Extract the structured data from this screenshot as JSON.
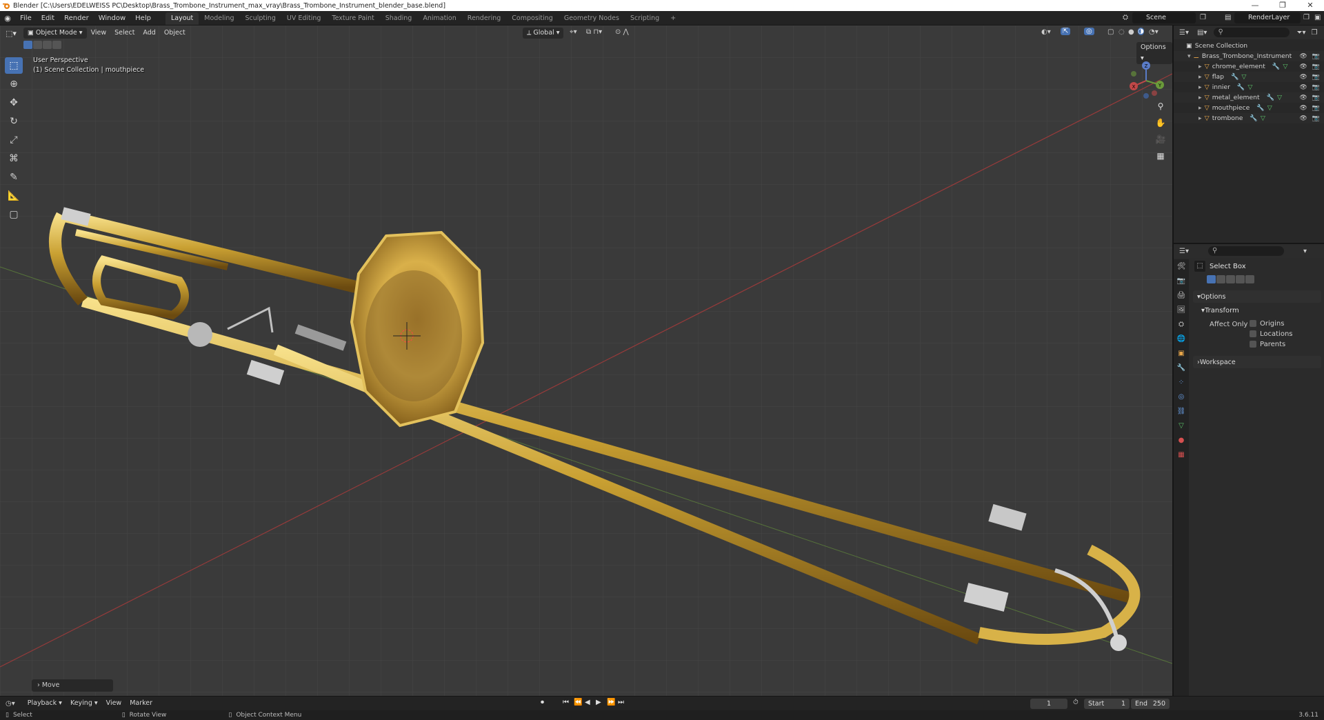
{
  "titlebar": {
    "title": "Blender [C:\\Users\\EDELWEISS PC\\Desktop\\Brass_Trombone_Instrument_max_vray\\Brass_Trombone_Instrument_blender_base.blend]",
    "minimize": "—",
    "maximize": "❐",
    "close": "✕"
  },
  "menu": {
    "items": [
      "File",
      "Edit",
      "Render",
      "Window",
      "Help"
    ]
  },
  "workspaces": {
    "tabs": [
      "Layout",
      "Modeling",
      "Sculpting",
      "UV Editing",
      "Texture Paint",
      "Shading",
      "Animation",
      "Rendering",
      "Compositing",
      "Geometry Nodes",
      "Scripting"
    ],
    "add": "+"
  },
  "scene": {
    "name": "Scene",
    "render_layer": "RenderLayer"
  },
  "viewport_header": {
    "mode": "Object Mode",
    "menus": [
      "View",
      "Select",
      "Add",
      "Object"
    ],
    "transform_orientation": "Global",
    "options": "Options"
  },
  "viewport": {
    "perspective": "User Perspective",
    "collection_info": "(1) Scene Collection | mouthpiece",
    "last_operation": "Move",
    "gizmo": {
      "x": "X",
      "y": "Y",
      "z": "Z"
    }
  },
  "outliner": {
    "root": "Scene Collection",
    "collection": "Brass_Trombone_Instrument",
    "objects": [
      "chrome_element",
      "flap",
      "innier",
      "metal_element",
      "mouthpiece",
      "trombone"
    ]
  },
  "properties": {
    "tool_name": "Select Box",
    "options_label": "Options",
    "transform_label": "Transform",
    "affect_only": "Affect Only",
    "checkboxes": [
      "Origins",
      "Locations",
      "Parents"
    ],
    "workspace_label": "Workspace"
  },
  "timeline": {
    "menus": [
      "Playback",
      "Keying",
      "View",
      "Marker"
    ],
    "current_frame": "1",
    "start_label": "Start",
    "start": "1",
    "end_label": "End",
    "end": "250"
  },
  "statusbar": {
    "select": "Select",
    "rotate": "Rotate View",
    "context": "Object Context Menu",
    "version": "3.6.11"
  },
  "colors": {
    "accent": "#4772b3",
    "brass": "#c9a032",
    "axis_x": "#b03a3a",
    "axis_y": "#6a9a3a"
  }
}
